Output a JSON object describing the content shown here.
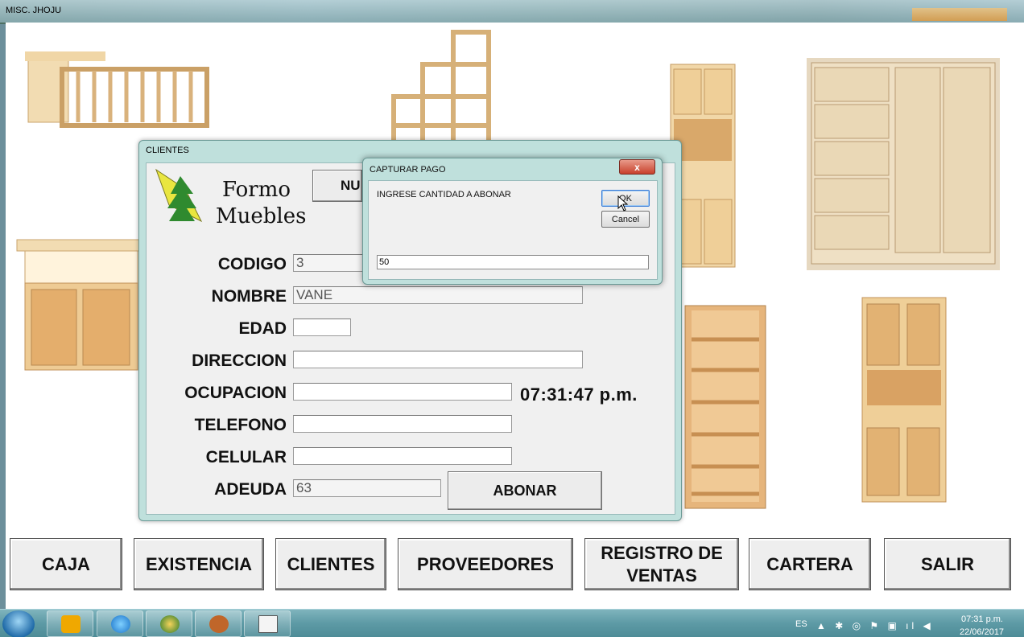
{
  "window": {
    "title": "MISC. JHOJU"
  },
  "logo": {
    "line1": "Formo",
    "line2": "Muebles"
  },
  "clientes_dialog": {
    "title": "CLIENTES",
    "hidden_button_label": "NU",
    "fields": [
      {
        "label": "CODIGO",
        "value": "3"
      },
      {
        "label": "NOMBRE",
        "value": "VANE"
      },
      {
        "label": "EDAD",
        "value": ""
      },
      {
        "label": "DIRECCION",
        "value": ""
      },
      {
        "label": "OCUPACION",
        "value": ""
      },
      {
        "label": "TELEFONO",
        "value": ""
      },
      {
        "label": "CELULAR",
        "value": ""
      },
      {
        "label": "ADEUDA",
        "value": "63"
      }
    ],
    "clock": "07:31:47 p.m.",
    "abonar_label": "ABONAR"
  },
  "pago_dialog": {
    "title": "CAPTURAR PAGO",
    "close_label": "x",
    "prompt": "INGRESE CANTIDAD A ABONAR",
    "ok_label": "OK",
    "cancel_label": "Cancel",
    "input_value": "50"
  },
  "nav": {
    "caja": "CAJA",
    "existencia": "EXISTENCIA",
    "clientes": "CLIENTES",
    "proveedores": "PROVEEDORES",
    "registro_line1": "REGISTRO DE",
    "registro_line2": "VENTAS",
    "cartera": "CARTERA",
    "salir": "SALIR"
  },
  "taskbar": {
    "language": "ES",
    "time": "07:31 p.m.",
    "date": "22/06/2017",
    "icons": [
      "windows-start-icon",
      "outlook-icon",
      "internet-explorer-icon",
      "globe-app-icon",
      "baseball-glove-icon",
      "folder-icon"
    ]
  }
}
